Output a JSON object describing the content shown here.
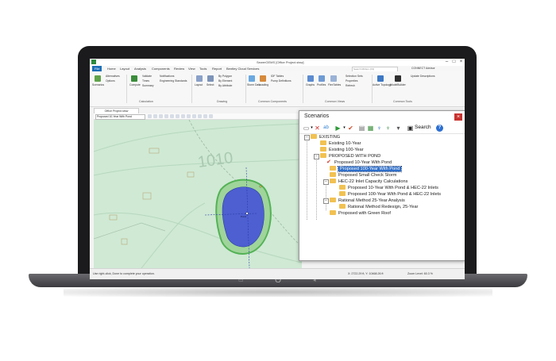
{
  "app": {
    "window_title": "SewerGEMS [Office Project.stsw]",
    "menu": [
      "File",
      "Home",
      "Layout",
      "Analysis",
      "Components",
      "Review",
      "View",
      "Tools",
      "Report",
      "Bentley Cloud Services"
    ],
    "search_placeholder": "Search Ribbon (F3)",
    "user_label": "CONNECT Advisor"
  },
  "ribbon": {
    "scenarios_label": "Scenarios",
    "alternatives_label": "Alternatives",
    "options_label": "Options",
    "compute_label": "Compute",
    "validate_label": "Validate",
    "notifications_label": "Notifications",
    "times_label": "Times",
    "engineering_standards_label": "Engineering Standards",
    "summary_label": "Summary",
    "layout_label": "Layout",
    "select_label": "Select",
    "by_polygon_label": "By Polygon",
    "by_element_label": "By Element",
    "by_attribute_label": "By Attribute",
    "storm_data_label": "Storm Data",
    "loading_label": "Loading",
    "idf_tables_label": "IDF Tables",
    "pump_definitions_label": "Pump Definitions",
    "graphs_label": "Graphs",
    "profiles_label": "Profiles",
    "flextables_label": "FlexTables",
    "selection_sets_label": "Selection Sets",
    "properties_label": "Properties",
    "refresh_label": "Refresh",
    "active_topology_label": "Active Topology",
    "modelbuilder_label": "ModelBuilder",
    "update_descriptions_label": "Update Descriptions",
    "group_calculation": "Calculation",
    "group_drawing": "Drawing",
    "group_common_components": "Common Components",
    "group_common_views": "Common Views",
    "group_common_tools": "Common Tools"
  },
  "document": {
    "tab_label": "Office Project.stsw",
    "scenario_select": "Proposed 10-Year With Pond"
  },
  "map": {
    "contour_label": "1010",
    "pond_label": "Pond",
    "colors": {
      "background": "#cfe9d4",
      "pond": "#4d5fd1",
      "buffer": "#53b255"
    }
  },
  "status": {
    "hint": "Use right-click, Done to complete your operation.",
    "coords": "X: 2722.29 ft, Y: 10468.26 ft",
    "zoom": "Zoom Level: 60.3 %"
  },
  "dialog": {
    "title": "Scenarios",
    "search_label": "Search",
    "tree": [
      {
        "label": "EXISTING",
        "level": 0,
        "expander": "⊟"
      },
      {
        "label": "Existing   10-Year",
        "level": 1
      },
      {
        "label": "Existing   100-Year",
        "level": 1
      },
      {
        "label": "PROPOSED WITH POND",
        "level": 1,
        "expander": "⊟"
      },
      {
        "label": "Proposed   10-Year With Pond",
        "level": 2,
        "active": true
      },
      {
        "label": "Proposed 100-Year With Pond",
        "level": 2,
        "selected": true
      },
      {
        "label": "Proposed Small Check Storm",
        "level": 2
      },
      {
        "label": "HEC-22 Inlet Capacity Calculations",
        "level": 2,
        "expander": "⊟"
      },
      {
        "label": "Proposed 10-Year With Pond & HEC-22 Inlets",
        "level": 3
      },
      {
        "label": "Proposed 100-Year With Pond & HEC-22 Inlets",
        "level": 3
      },
      {
        "label": "Rational Method 25-Year Analysis",
        "level": 2,
        "expander": "⊟"
      },
      {
        "label": "Rational Method Redesign, 25-Year",
        "level": 3
      },
      {
        "label": "Proposed with Green Roof",
        "level": 2
      }
    ]
  }
}
